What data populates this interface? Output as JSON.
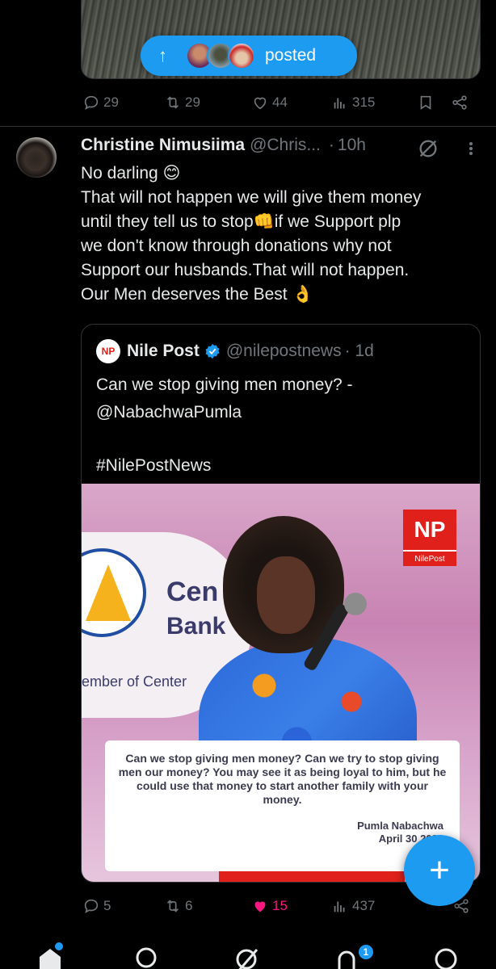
{
  "top_tweet": {
    "posted_pill": {
      "arrow": "↑",
      "label": "posted"
    },
    "actions": {
      "replies": "29",
      "reposts": "29",
      "likes": "44",
      "views": "315"
    }
  },
  "tweet": {
    "author_name": "Christine Nimusiima",
    "author_handle": "@Chris...",
    "separator": "·",
    "time": "10h",
    "lines": [
      "No darling 😊",
      "That will not happen we will give them money",
      "until they tell us to stop👊if we  Support plp",
      "we don't know through donations why not",
      "Support our husbands.That will not happen.",
      "Our Men deserves the Best 👌"
    ],
    "quote": {
      "logo_text": "NP",
      "name": "Nile Post",
      "handle": "@nilepostnews",
      "time": "· 1d",
      "text_lines": [
        "Can we stop giving men money? -",
        "@NabachwaPumla",
        "",
        "#NilePostNews"
      ],
      "media": {
        "bank_line1": "Cen",
        "bank_line2": "Bank",
        "bank_line3": "ember of Center",
        "np_badge_top": "NP",
        "np_badge_bottom": "NilePost",
        "caption": "Can we stop giving men money? Can we try to stop giving men our money? You may see it as being loyal to him, but he could use that money to start another family with your money.",
        "caption_name": "Pumla Nabachwa",
        "caption_date": "April 30 2026"
      }
    },
    "actions": {
      "replies": "5",
      "reposts": "6",
      "likes": "15",
      "views": "437"
    }
  },
  "fab": {
    "label": "+"
  },
  "nav": {
    "notifications_badge": "1"
  },
  "colors": {
    "accent": "#1d9bf0",
    "like_active": "#f91880",
    "muted": "#71767b",
    "background": "#000000"
  }
}
